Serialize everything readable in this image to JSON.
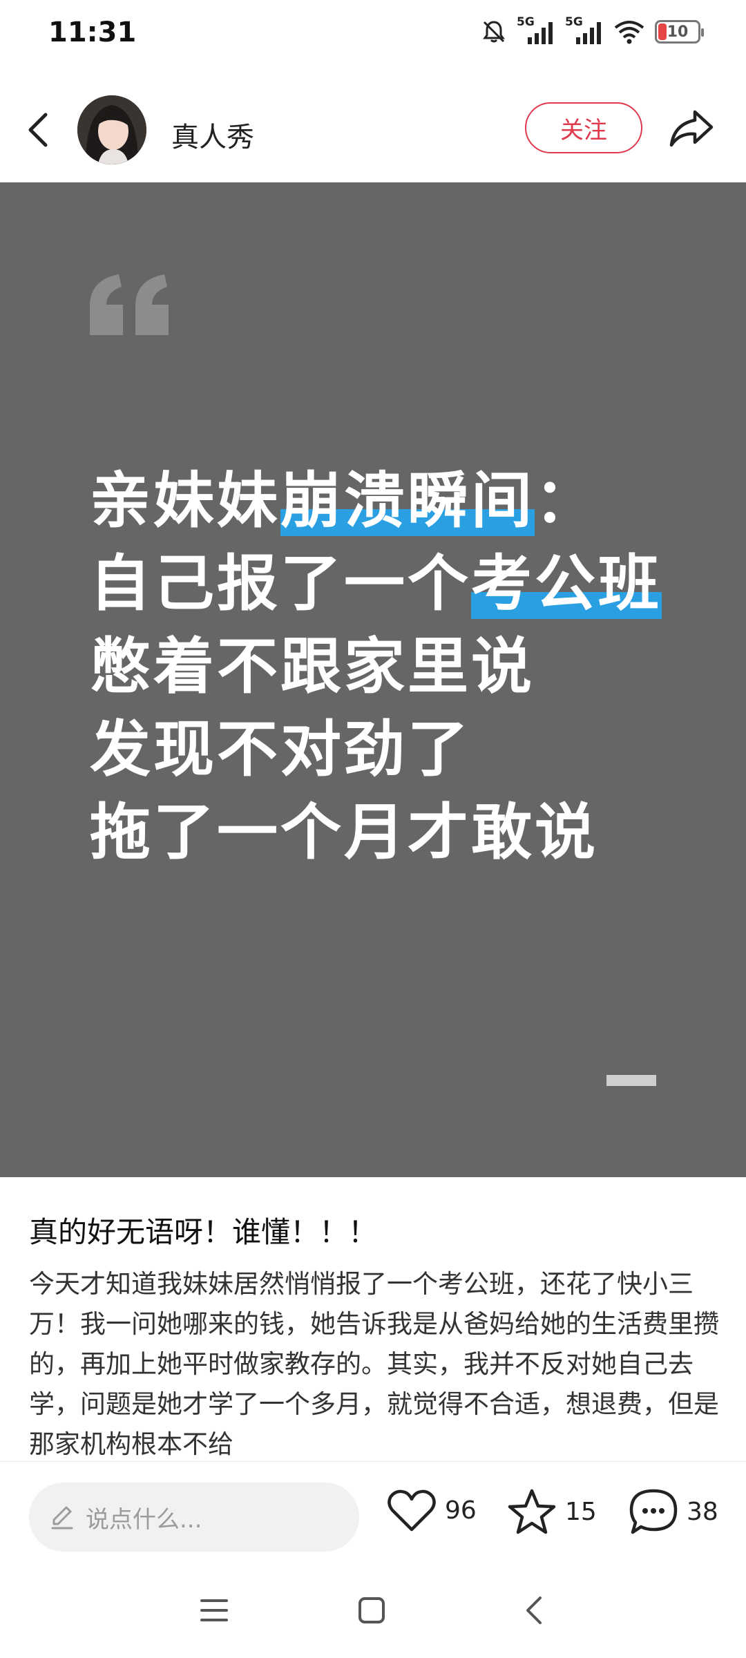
{
  "status_bar": {
    "time": "11:31",
    "battery_level": "10",
    "net1": "5G",
    "net2": "5G"
  },
  "header": {
    "username": "真人秀",
    "follow_label": "关注"
  },
  "post_image": {
    "lines": [
      [
        "亲妹妹",
        "崩溃瞬间",
        "："
      ],
      [
        "自己报了一个",
        "考公班",
        ""
      ],
      [
        "憋着不跟家里说",
        "",
        ""
      ],
      [
        "发现不对劲了",
        "",
        ""
      ],
      [
        "拖了一个月才敢说",
        "",
        ""
      ]
    ]
  },
  "post": {
    "title": "真的好无语呀！谁懂！！！",
    "body": "今天才知道我妹妹居然悄悄报了一个考公班，还花了快小三万！我一问她哪来的钱，她告诉我是从爸妈给她的生活费里攒的，再加上她平时做家教存的。其实，我并不反对她自己去学，问题是她才学了一个多月，就觉得不合适，想退费，但是那家机构根本不给"
  },
  "actions": {
    "comment_placeholder": "说点什么...",
    "likes": "96",
    "favorites": "15",
    "comments": "38"
  },
  "colors": {
    "accent": "#e0384c",
    "highlight": "#2aa0e3",
    "image_bg": "#666666"
  }
}
